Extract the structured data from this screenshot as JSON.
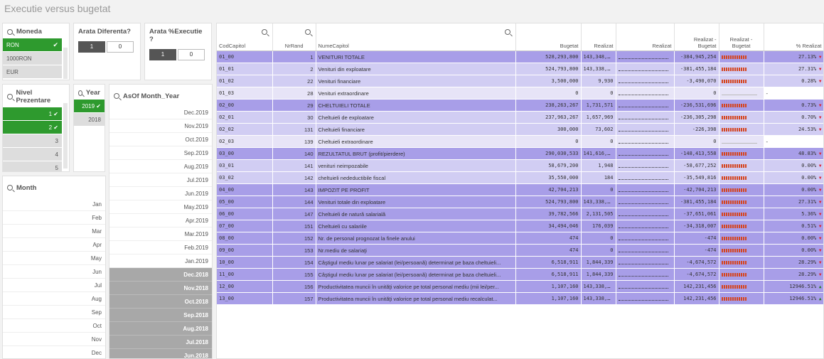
{
  "title": "Executie versus bugetat",
  "moneda": {
    "title": "Moneda",
    "items": [
      "RON",
      "1000RON",
      "EUR"
    ]
  },
  "diferenta": {
    "title": "Arata Diferenta?",
    "on": "1",
    "off": "0"
  },
  "executie": {
    "title": "Arata %Executie ?",
    "on": "1",
    "off": "0"
  },
  "nivel": {
    "title": "Nivel Prezentare",
    "items": [
      "1",
      "2",
      "3",
      "4",
      "5"
    ]
  },
  "year": {
    "title": "Year",
    "items": [
      "2019",
      "2018"
    ]
  },
  "asof": {
    "title": "AsOf Month_Year",
    "items": [
      "Dec.2019",
      "Nov.2019",
      "Oct.2019",
      "Sep.2019",
      "Aug.2019",
      "Jul.2019",
      "Jun.2019",
      "May.2019",
      "Apr.2019",
      "Mar.2019",
      "Feb.2019",
      "Jan.2019",
      "Dec.2018",
      "Nov.2018",
      "Oct.2018",
      "Sep.2018",
      "Aug.2018",
      "Jul.2018",
      "Jun.2018"
    ]
  },
  "month": {
    "title": "Month",
    "items": [
      "Jan",
      "Feb",
      "Mar",
      "Apr",
      "May",
      "Jun",
      "Jul",
      "Aug",
      "Sep",
      "Oct",
      "Nov",
      "Dec"
    ]
  },
  "table": {
    "headers": [
      "CodCapitol",
      "NrRand",
      "NumeCapitol",
      "Bugetat",
      "Realizat",
      "Realizat",
      "Realizat - Bugetat",
      "Realizat - Bugetat",
      "% Realizat"
    ],
    "rows": [
      [
        "01_00",
        "1",
        "VENITURI TOTALE",
        "528,293,800",
        "143,348,...",
        "-384,945,254",
        "27.13%"
      ],
      [
        "01_01",
        "2",
        "Venituri din exploatare",
        "524,793,800",
        "143,338,...",
        "-381,455,184",
        "27.31%"
      ],
      [
        "01_02",
        "22",
        "Venituri financiare",
        "3,500,000",
        "9,930",
        "-3,490,070",
        "0.28%"
      ],
      [
        "01_03",
        "28",
        "Venituri extraordinare",
        "0",
        "0",
        "0",
        "-"
      ],
      [
        "02_00",
        "29",
        "CHELTUIELI TOTALE",
        "238,263,267",
        "1,731,571",
        "-236,531,696",
        "0.73%"
      ],
      [
        "02_01",
        "30",
        "Cheltuieli de exploatare",
        "237,963,267",
        "1,657,969",
        "-236,305,298",
        "0.70%"
      ],
      [
        "02_02",
        "131",
        "Cheltuieli financiare",
        "300,000",
        "73,602",
        "-226,398",
        "24.53%"
      ],
      [
        "02_03",
        "139",
        "Cheltuieli extraordinare",
        "0",
        "0",
        "0",
        "-"
      ],
      [
        "03_00",
        "140",
        "REZULTATUL BRUT (profit/pierdere)",
        "290,030,533",
        "141,616,...",
        "-148,413,558",
        "48.83%"
      ],
      [
        "03_01",
        "141",
        "venituri neimpozabile",
        "58,679,200",
        "1,948",
        "-58,677,252",
        "0.00%"
      ],
      [
        "03_02",
        "142",
        "cheltuieli nedeductibile fiscal",
        "35,550,000",
        "184",
        "-35,549,816",
        "0.00%"
      ],
      [
        "04_00",
        "143",
        "IMPOZIT PE PROFIT",
        "42,704,213",
        "0",
        "-42,704,213",
        "0.00%"
      ],
      [
        "05_00",
        "144",
        "Venituri totale din exploatare",
        "524,793,800",
        "143,338,...",
        "-381,455,184",
        "27.31%"
      ],
      [
        "06_00",
        "147",
        "Cheltuieli de natură salarială",
        "39,782,566",
        "2,131,505",
        "-37,651,061",
        "5.36%"
      ],
      [
        "07_00",
        "151",
        "Cheltuieli cu salariile",
        "34,494,046",
        "176,039",
        "-34,318,007",
        "0.51%"
      ],
      [
        "08_00",
        "152",
        "Nr. de personal prognozat la finele anului",
        "474",
        "0",
        "-474",
        "0.00%"
      ],
      [
        "09_00",
        "153",
        "Nr.mediu de salariaţi",
        "474",
        "0",
        "-474",
        "0.00%"
      ],
      [
        "10_00",
        "154",
        "Câştigul mediu lunar pe salariat (lei/persoană) determinat pe baza cheltuieli...",
        "6,518,911",
        "1,844,339",
        "-4,674,572",
        "28.29%"
      ],
      [
        "11_00",
        "155",
        "Câştigul mediu lunar pe salariat (lei/persoană) determinat pe baza cheltuieli...",
        "6,518,911",
        "1,844,339",
        "-4,674,572",
        "28.29%"
      ],
      [
        "12_00",
        "156",
        "Productivitatea muncii în unităţi valorice pe total personal mediu (mii lei/per...",
        "1,107,160",
        "143,338,...",
        "142,231,456",
        "12946.51%"
      ],
      [
        "13_00",
        "157",
        "Productivitatea muncii în unităţi valorice pe total personal mediu recalculat...",
        "1,107,160",
        "143,338,...",
        "142,231,456",
        "12946.51%"
      ]
    ]
  }
}
